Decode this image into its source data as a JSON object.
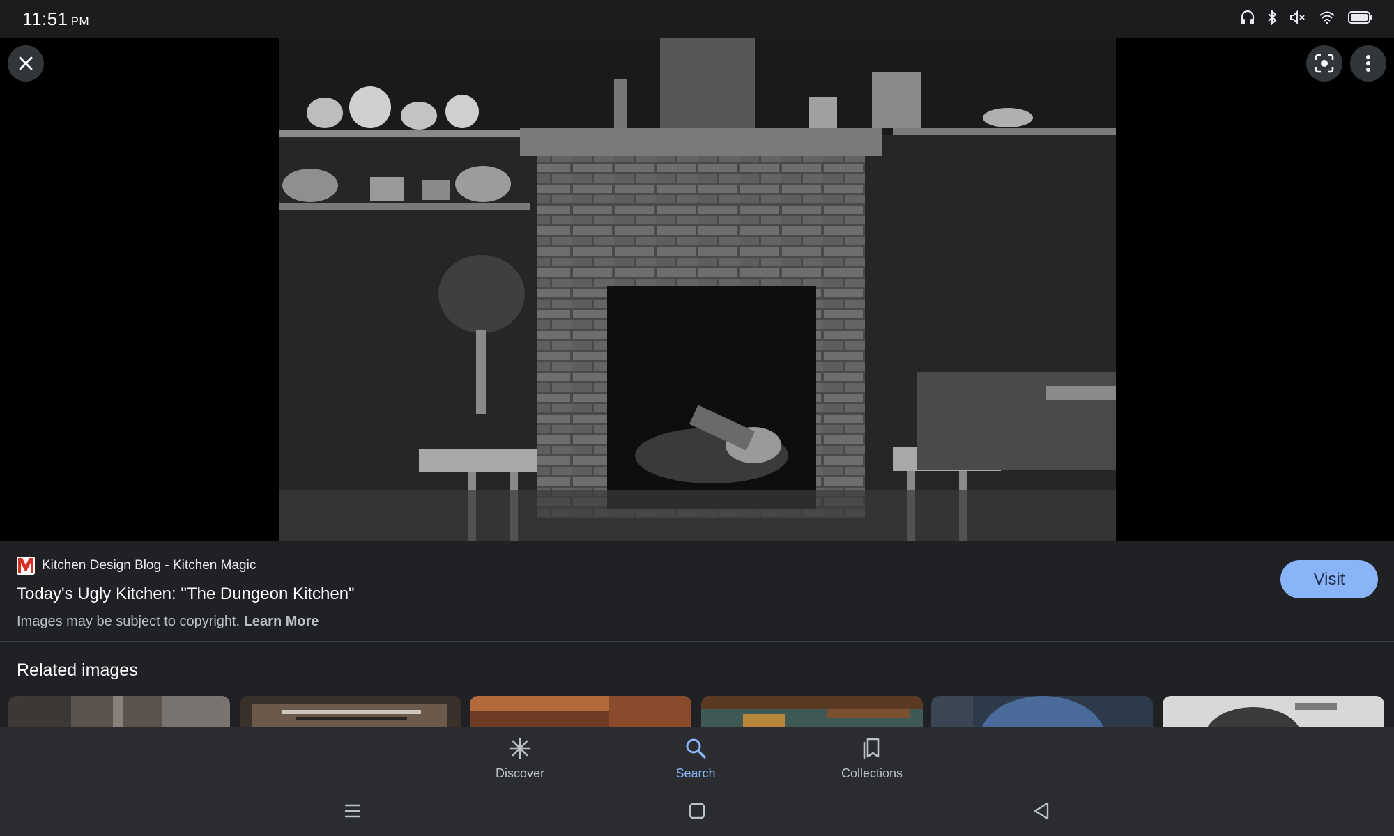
{
  "status_bar": {
    "time": "11:51",
    "ampm": "PM",
    "icons": [
      "headphones-icon",
      "bluetooth-icon",
      "volume-muted-icon",
      "wifi-icon",
      "battery-icon"
    ]
  },
  "viewer": {
    "image_subject": "fireplace-kitchen-photo",
    "buttons": [
      "close-icon",
      "lens-icon",
      "more-vert-icon"
    ]
  },
  "info": {
    "source_name": "Kitchen Design Blog - Kitchen Magic",
    "title": "Today's Ugly Kitchen: \"The Dungeon Kitchen\"",
    "copyright_text": "Images may be subject to copyright.",
    "learn_more": "Learn More",
    "visit_label": "Visit",
    "accent_color": "#8ab4f8",
    "logo_color": "#d93025"
  },
  "related": {
    "heading": "Related images",
    "thumbnails": [
      {
        "colors": [
          "#5b534e",
          "#8a807a"
        ]
      },
      {
        "colors": [
          "#3a302a",
          "#cfc7bd"
        ]
      },
      {
        "colors": [
          "#6e3b24",
          "#b56a3c"
        ]
      },
      {
        "colors": [
          "#3f5a55",
          "#b8863a"
        ]
      },
      {
        "colors": [
          "#2c3a4a",
          "#4a6a9a"
        ]
      },
      {
        "colors": [
          "#d8d8d8",
          "#3a3a3a"
        ]
      }
    ]
  },
  "bottom_nav": {
    "items": [
      {
        "label": "Discover",
        "icon": "asterisk-icon",
        "active": false
      },
      {
        "label": "Search",
        "icon": "search-icon",
        "active": true
      },
      {
        "label": "Collections",
        "icon": "bookmarks-icon",
        "active": false
      }
    ]
  },
  "system_nav": [
    "recents-icon",
    "home-icon",
    "back-icon"
  ]
}
